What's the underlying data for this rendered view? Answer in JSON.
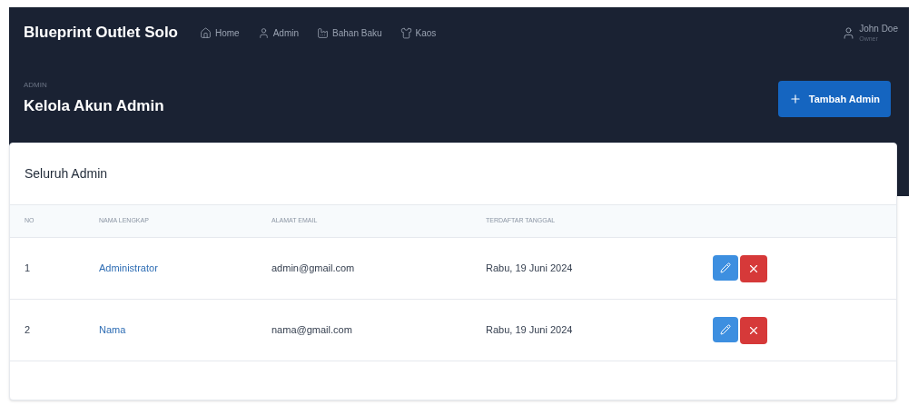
{
  "brand": "Blueprint Outlet Solo",
  "nav": [
    {
      "kind": "home",
      "label": "Home"
    },
    {
      "kind": "user",
      "label": "Admin"
    },
    {
      "kind": "factory",
      "label": "Bahan Baku"
    },
    {
      "kind": "shirt",
      "label": "Kaos"
    }
  ],
  "user": {
    "name": "John Doe",
    "role": "Owner"
  },
  "page": {
    "pretitle": "ADMIN",
    "title": "Kelola Akun Admin",
    "add_button": "Tambah Admin"
  },
  "card": {
    "title": "Seluruh Admin",
    "columns": [
      "NO",
      "NAMA LENGKAP",
      "ALAMAT EMAIL",
      "TERDAFTAR TANGGAL"
    ],
    "rows": [
      {
        "no": "1",
        "name": "Administrator",
        "email": "admin@gmail.com",
        "date": "Rabu, 19 Juni 2024"
      },
      {
        "no": "2",
        "name": "Nama",
        "email": "nama@gmail.com",
        "date": "Rabu, 19 Juni 2024"
      }
    ]
  }
}
